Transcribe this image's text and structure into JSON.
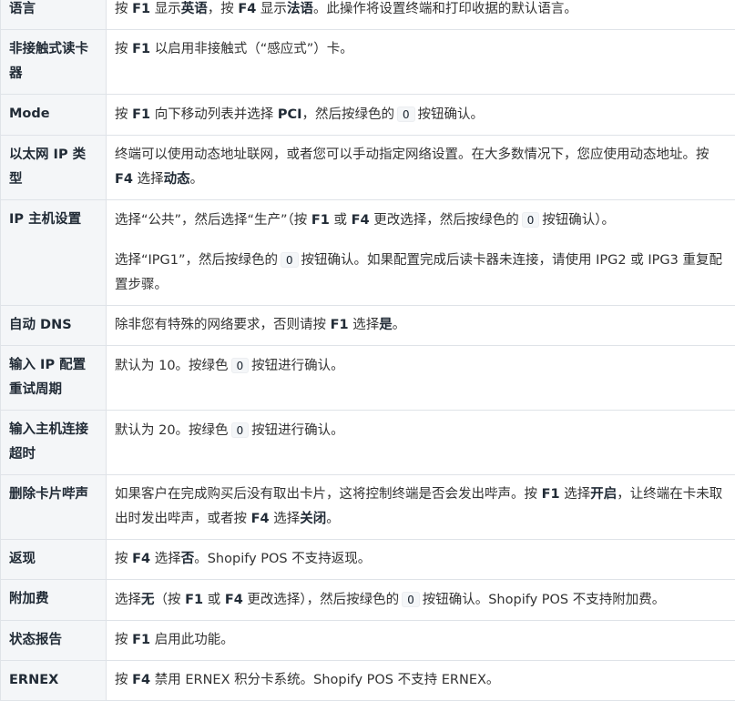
{
  "rows": [
    {
      "label": "语言",
      "segs": [
        [
          "t",
          "按 "
        ],
        [
          "b",
          "F1"
        ],
        [
          "t",
          " 显示"
        ],
        [
          "b",
          "英语"
        ],
        [
          "t",
          "，按 "
        ],
        [
          "b",
          "F4"
        ],
        [
          "t",
          " 显示"
        ],
        [
          "b",
          "法语"
        ],
        [
          "t",
          "。此操作将设置终端和打印收据的默认语言。"
        ]
      ]
    },
    {
      "label": "非接触式读卡器",
      "segs": [
        [
          "t",
          "按 "
        ],
        [
          "b",
          "F1"
        ],
        [
          "t",
          " 以启用非接触式（“感应式”）卡。"
        ]
      ]
    },
    {
      "label": "Mode",
      "segs": [
        [
          "t",
          "按 "
        ],
        [
          "b",
          "F1"
        ],
        [
          "t",
          " 向下移动列表并选择 "
        ],
        [
          "b",
          "PCI"
        ],
        [
          "t",
          "，然后按绿色的"
        ],
        [
          "c",
          "O"
        ],
        [
          "t",
          "按钮确认。"
        ]
      ]
    },
    {
      "label": "以太网 IP 类型",
      "segs": [
        [
          "t",
          "终端可以使用动态地址联网，或者您可以手动指定网络设置。在大多数情况下，您应使用动态地址。按 "
        ],
        [
          "b",
          "F4"
        ],
        [
          "t",
          " 选择"
        ],
        [
          "b",
          "动态"
        ],
        [
          "t",
          "。"
        ]
      ]
    },
    {
      "label": "IP 主机设置",
      "paras": [
        [
          [
            "t",
            "选择“公共”，然后选择“生产”（按 "
          ],
          [
            "b",
            "F1"
          ],
          [
            "t",
            " 或 "
          ],
          [
            "b",
            "F4"
          ],
          [
            "t",
            " 更改选择，然后按绿色的"
          ],
          [
            "c",
            "O"
          ],
          [
            "t",
            "按钮确认）。"
          ]
        ],
        [
          [
            "t",
            "选择“IPG1”，然后按绿色的"
          ],
          [
            "c",
            "O"
          ],
          [
            "t",
            "按钮确认。如果配置完成后读卡器未连接，请使用 IPG2 或 IPG3 重复配置步骤。"
          ]
        ]
      ]
    },
    {
      "label": "自动 DNS",
      "segs": [
        [
          "t",
          "除非您有特殊的网络要求，否则请按 "
        ],
        [
          "b",
          "F1"
        ],
        [
          "t",
          " 选择"
        ],
        [
          "b",
          "是"
        ],
        [
          "t",
          "。"
        ]
      ]
    },
    {
      "label": "输入 IP 配置重试周期",
      "segs": [
        [
          "t",
          "默认为 10。按绿色"
        ],
        [
          "c",
          "O"
        ],
        [
          "t",
          "按钮进行确认。"
        ]
      ]
    },
    {
      "label": "输入主机连接超时",
      "segs": [
        [
          "t",
          "默认为 20。按绿色"
        ],
        [
          "c",
          "O"
        ],
        [
          "t",
          "按钮进行确认。"
        ]
      ]
    },
    {
      "label": "删除卡片哔声",
      "segs": [
        [
          "t",
          "如果客户在完成购买后没有取出卡片，这将控制终端是否会发出哔声。按 "
        ],
        [
          "b",
          "F1"
        ],
        [
          "t",
          " 选择"
        ],
        [
          "b",
          "开启"
        ],
        [
          "t",
          "，让终端在卡未取出时发出哔声，或者按 "
        ],
        [
          "b",
          "F4"
        ],
        [
          "t",
          " 选择"
        ],
        [
          "b",
          "关闭"
        ],
        [
          "t",
          "。"
        ]
      ]
    },
    {
      "label": "返现",
      "segs": [
        [
          "t",
          "按 "
        ],
        [
          "b",
          "F4"
        ],
        [
          "t",
          " 选择"
        ],
        [
          "b",
          "否"
        ],
        [
          "t",
          "。Shopify POS 不支持返现。"
        ]
      ]
    },
    {
      "label": "附加费",
      "segs": [
        [
          "t",
          "选择"
        ],
        [
          "b",
          "无"
        ],
        [
          "t",
          "（按 "
        ],
        [
          "b",
          "F1"
        ],
        [
          "t",
          " 或 "
        ],
        [
          "b",
          "F4"
        ],
        [
          "t",
          " 更改选择），然后按绿色的"
        ],
        [
          "c",
          "O"
        ],
        [
          "t",
          "按钮确认。Shopify POS 不支持附加费。"
        ]
      ]
    },
    {
      "label": "状态报告",
      "segs": [
        [
          "t",
          "按 "
        ],
        [
          "b",
          "F1"
        ],
        [
          "t",
          " 启用此功能。"
        ]
      ]
    },
    {
      "label": "ERNEX",
      "segs": [
        [
          "t",
          "按 "
        ],
        [
          "b",
          "F4"
        ],
        [
          "t",
          " 禁用 ERNEX 积分卡系统。Shopify POS 不支持 ERNEX。"
        ]
      ]
    }
  ]
}
